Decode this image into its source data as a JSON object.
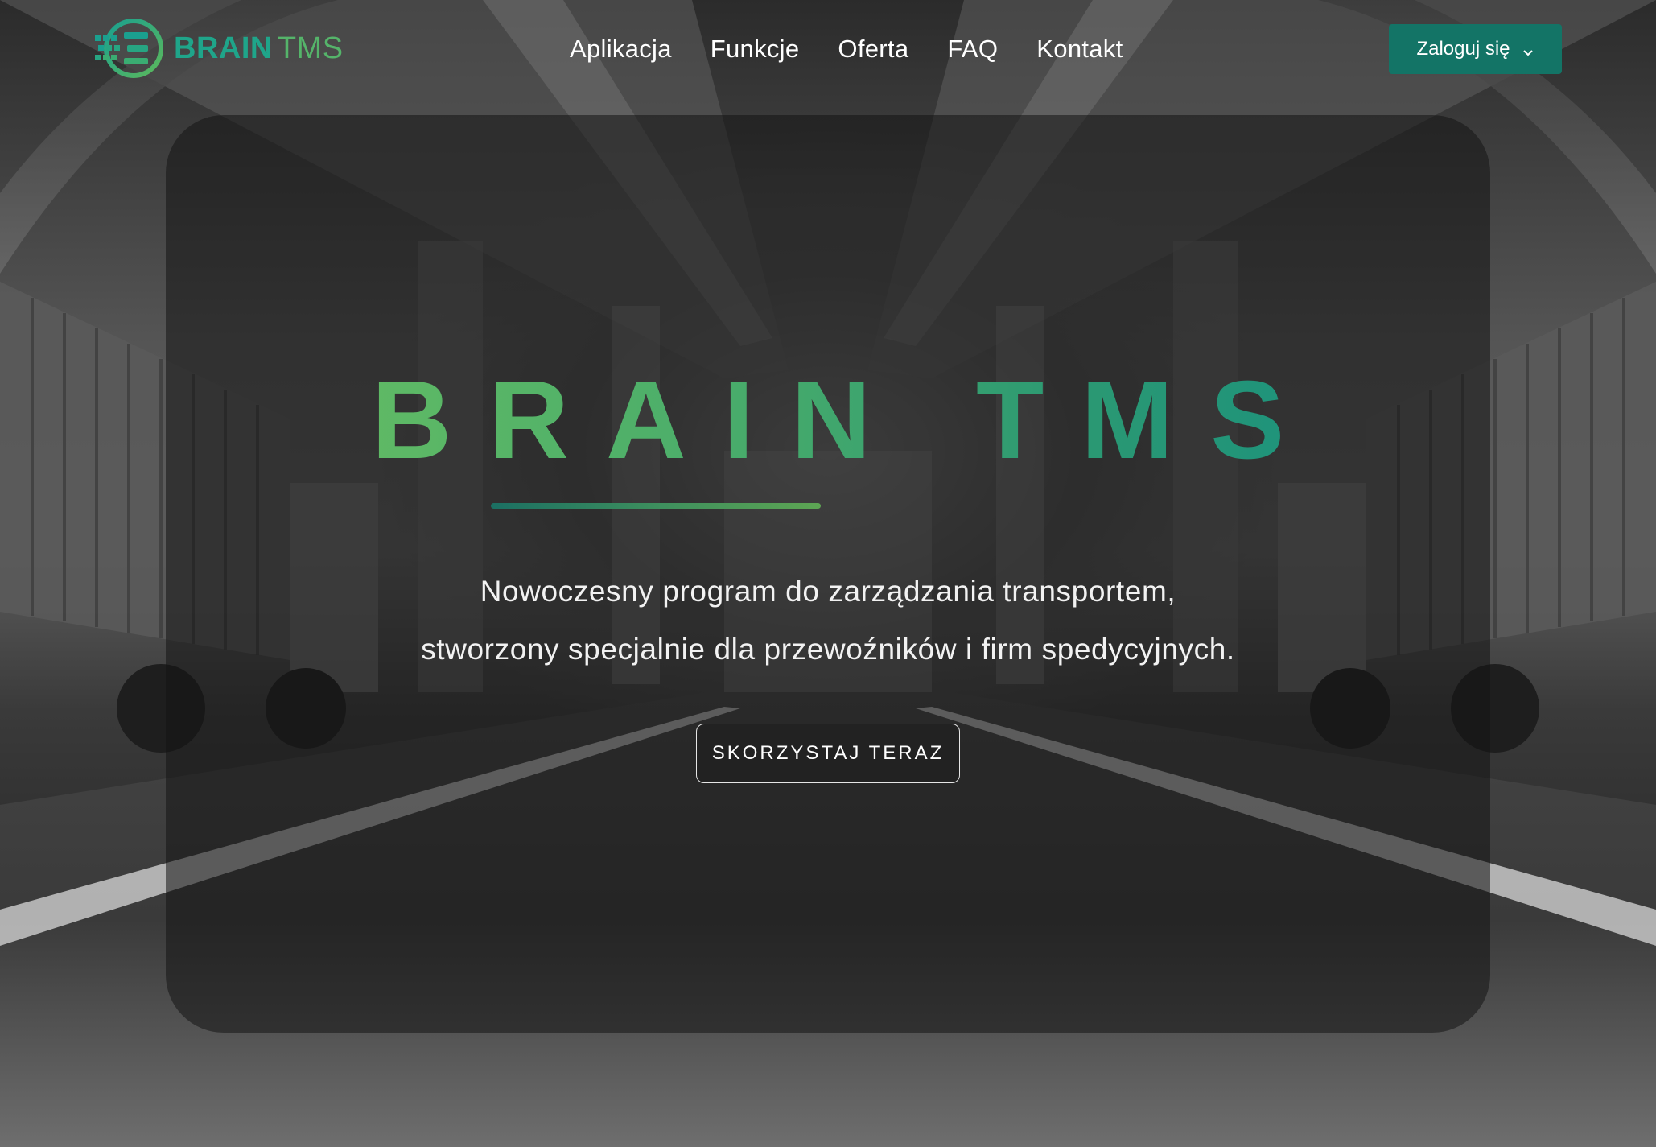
{
  "header": {
    "logo": {
      "brand_bold": "BRAIN",
      "brand_light": "TMS"
    },
    "nav": [
      {
        "label": "Aplikacja"
      },
      {
        "label": "Funkcje"
      },
      {
        "label": "Oferta"
      },
      {
        "label": "FAQ"
      },
      {
        "label": "Kontakt"
      }
    ],
    "login_label": "Zaloguj się",
    "login_icon": "chevron-down-icon"
  },
  "hero": {
    "title": "BRAIN TMS",
    "subtitle_line1": "Nowoczesny program do zarządzania transportem,",
    "subtitle_line2": "stworzony specjalnie dla przewoźników i firm spedycyjnych.",
    "cta_label": "SKORZYSTAJ TERAZ"
  },
  "colors": {
    "accent": "#137466",
    "brand_teal": "#1fa58a",
    "brand_green": "#55b46a",
    "title_gradient_start": "#6ac062",
    "title_gradient_end": "#148f82"
  }
}
